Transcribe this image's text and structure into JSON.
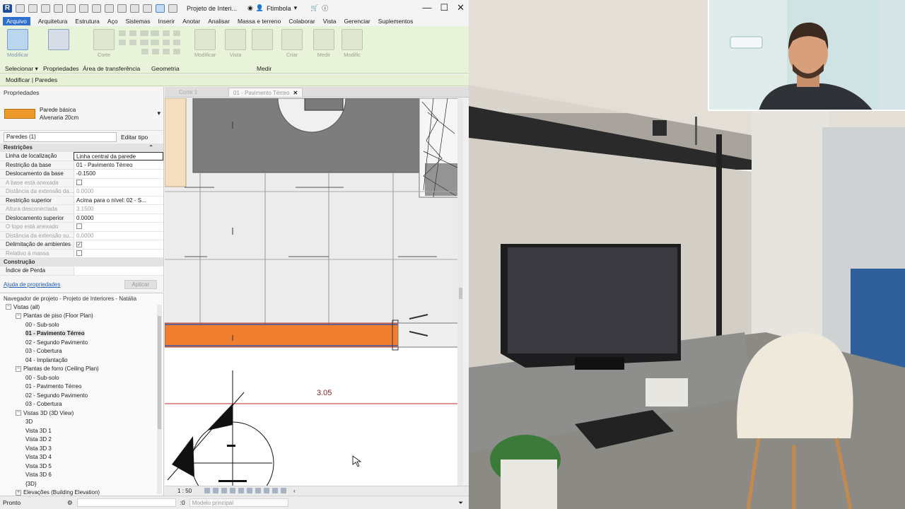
{
  "app": {
    "title": "Projeto de Interi...",
    "user": "Ftimbola",
    "window_controls": [
      "—",
      "☐",
      "✕"
    ]
  },
  "menu": [
    "Arquivo",
    "Arquitetura",
    "Estrutura",
    "Aço",
    "Sistemas",
    "Inserir",
    "Anotar",
    "Analisar",
    "Massa e terreno",
    "Colaborar",
    "Vista",
    "Gerenciar",
    "Suplementos"
  ],
  "ribbon": {
    "buttons": {
      "modify": "Modificar",
      "cut": "Corte",
      "modify2": "Modificar",
      "view": "Vista",
      "create": "Criar",
      "measure": "Medir",
      "modify3": "Modific"
    },
    "panels": {
      "select": "Selecionar ▾",
      "props": "Propriedades",
      "clipboard": "Área de transferência",
      "geometry": "Geometria",
      "measure": "Medir"
    }
  },
  "context": "Modificar | Paredes",
  "properties": {
    "header": "Propriedades",
    "type_name": "Parede básica",
    "type_sub": "Alvenaria 20cm",
    "filter": "Paredes (1)",
    "edit_type": "Editar tipo",
    "group_constraints": "Restrições",
    "rows": [
      {
        "k": "Linha de localização",
        "v": "Linha central da parede"
      },
      {
        "k": "Restrição da base",
        "v": "01 - Pavimento Térreo"
      },
      {
        "k": "Deslocamento da base",
        "v": "-0.1500"
      },
      {
        "k": "A base está anexada",
        "v": ""
      },
      {
        "k": "Distância da extensão da...",
        "v": "0.0000"
      },
      {
        "k": "Restrição superior",
        "v": "Acima para o nível: 02 - S..."
      },
      {
        "k": "Altura desconectada",
        "v": "3.1500"
      },
      {
        "k": "Deslocamento superior",
        "v": "0.0000"
      },
      {
        "k": "O topo está anexado",
        "v": ""
      },
      {
        "k": "Distância da extensão su...",
        "v": "0.0000"
      },
      {
        "k": "Delimitação de ambientes",
        "v": "✓"
      },
      {
        "k": "Relativo à massa",
        "v": ""
      }
    ],
    "group_construction": "Construção",
    "row_loss": "Índice de Perda",
    "help_link": "Ajuda de propriedades",
    "apply": "Aplicar"
  },
  "navigator": {
    "header": "Navegador de projeto - Projeto de Interiores - Natália",
    "items": [
      {
        "label": "Vistas (all)",
        "level": 0,
        "toggle": "−"
      },
      {
        "label": "Plantas de piso (Floor Plan)",
        "level": 1,
        "toggle": "−"
      },
      {
        "label": "00 - Sub-solo",
        "level": 2
      },
      {
        "label": "01 - Pavimento Térreo",
        "level": 2,
        "bold": true
      },
      {
        "label": "02 - Segundo Pavimento",
        "level": 2
      },
      {
        "label": "03 - Cobertura",
        "level": 2
      },
      {
        "label": "04 - Implantação",
        "level": 2
      },
      {
        "label": "Plantas de forro (Ceiling Plan)",
        "level": 1,
        "toggle": "−"
      },
      {
        "label": "00 - Sub-solo",
        "level": 2
      },
      {
        "label": "01 - Pavimento Térreo",
        "level": 2
      },
      {
        "label": "02 - Segundo Pavimento",
        "level": 2
      },
      {
        "label": "03 - Cobertura",
        "level": 2
      },
      {
        "label": "Vistas 3D (3D View)",
        "level": 1,
        "toggle": "−"
      },
      {
        "label": "3D",
        "level": 2
      },
      {
        "label": "Vista 3D 1",
        "level": 2
      },
      {
        "label": "Vista 3D 2",
        "level": 2
      },
      {
        "label": "Vista 3D 3",
        "level": 2
      },
      {
        "label": "Vista 3D 4",
        "level": 2
      },
      {
        "label": "Vista 3D 5",
        "level": 2
      },
      {
        "label": "Vista 3D 6",
        "level": 2
      },
      {
        "label": "{3D}",
        "level": 2
      },
      {
        "label": "Elevações (Building Elevation)",
        "level": 1,
        "toggle": "+"
      }
    ]
  },
  "tabs": [
    {
      "label": "Corte 1"
    },
    {
      "label": "01 - Pavimento Térreo",
      "active": true
    }
  ],
  "canvas": {
    "dimension": "3.05"
  },
  "view_control": {
    "scale": "1 : 50"
  },
  "status": {
    "text": "Pronto",
    "count": ":0",
    "model": "Modelo principal"
  },
  "colors": {
    "ribbon": "#e9f3d9",
    "wall": "#ef7f2e",
    "accent": "#2f6fcf",
    "dimension": "#b3242a"
  }
}
